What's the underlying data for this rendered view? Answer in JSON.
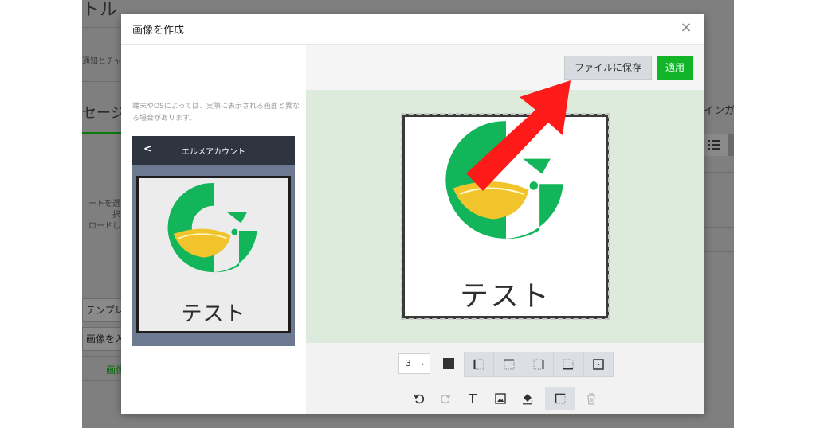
{
  "background": {
    "title_fragment": "トル",
    "note_fragment": "通知とチャ",
    "heading_fragment": "セージ",
    "drop_text_line1": "ートを選択",
    "drop_text_line2": "ロードし",
    "template_button": "テンプレ",
    "image_button": "画像を入",
    "link_fragment": "画像",
    "right_label": "インガー"
  },
  "modal": {
    "title": "画像を作成",
    "close_label": "×"
  },
  "left_panel": {
    "note": "端末やOSによっては、実際に表示される画面と異なる場合があります。",
    "phone_back": "<",
    "phone_title": "エルメアカウント",
    "image_text": "テスト"
  },
  "right_panel": {
    "save_button": "ファイルに保存",
    "apply_button": "適用",
    "canvas_text": "テスト",
    "border_size": "3",
    "border_color": "#333333",
    "apply_color": "#12b528",
    "canvas_bg": "#dcebdc",
    "border_tools": [
      "border-left-icon",
      "border-top-icon",
      "border-right-icon",
      "border-bottom-icon",
      "border-all-icon"
    ],
    "tools": [
      "undo-icon",
      "redo-icon",
      "text-icon",
      "image-icon",
      "fill-icon",
      "border-icon",
      "trash-icon"
    ]
  },
  "annotation": {
    "arrow_color": "#ff1a1a"
  }
}
